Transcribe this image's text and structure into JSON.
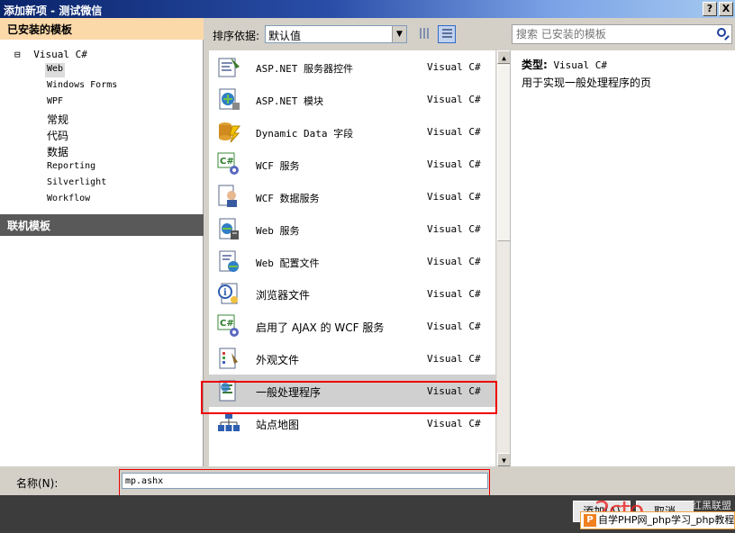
{
  "window": {
    "title": "添加新项 - 测试微信",
    "help_button": "?",
    "close_button": "X"
  },
  "left_panel": {
    "installed_header": "已安装的模板",
    "tree": {
      "root_expander": "⊟",
      "root_label": "Visual C#",
      "children": [
        "Web",
        "Windows Forms",
        "WPF",
        "常规",
        "代码",
        "数据",
        "Reporting",
        "Silverlight",
        "Workflow"
      ],
      "selected": "Web"
    },
    "online_header": "联机模板"
  },
  "toolbar": {
    "sort_label": "排序依据:",
    "sort_value": "默认值",
    "search_placeholder": "搜索 已安装的模板"
  },
  "items": [
    {
      "name": "ASP.NET 服务器控件",
      "lang": "Visual C#",
      "icon": "server-control-icon"
    },
    {
      "name": "ASP.NET 模块",
      "lang": "Visual C#",
      "icon": "module-icon"
    },
    {
      "name": "Dynamic Data 字段",
      "lang": "Visual C#",
      "icon": "dynamic-data-icon"
    },
    {
      "name": "WCF 服务",
      "lang": "Visual C#",
      "icon": "wcf-service-icon"
    },
    {
      "name": "WCF 数据服务",
      "lang": "Visual C#",
      "icon": "wcf-data-service-icon"
    },
    {
      "name": "Web 服务",
      "lang": "Visual C#",
      "icon": "web-service-icon"
    },
    {
      "name": "Web 配置文件",
      "lang": "Visual C#",
      "icon": "web-config-icon"
    },
    {
      "name": "浏览器文件",
      "lang": "Visual C#",
      "icon": "browser-file-icon"
    },
    {
      "name": "启用了 AJAX 的 WCF 服务",
      "lang": "Visual C#",
      "icon": "ajax-wcf-service-icon"
    },
    {
      "name": "外观文件",
      "lang": "Visual C#",
      "icon": "skin-file-icon"
    },
    {
      "name": "一般处理程序",
      "lang": "Visual C#",
      "icon": "generic-handler-icon"
    },
    {
      "name": "站点地图",
      "lang": "Visual C#",
      "icon": "sitemap-icon"
    }
  ],
  "selected_item": "一般处理程序",
  "details": {
    "type_label": "类型:",
    "type_value": "Visual C#",
    "description": "用于实现一般处理程序的页"
  },
  "name_field": {
    "label": "名称(N):",
    "value": "mp.ashx"
  },
  "buttons": {
    "add": "添加(A)",
    "cancel": "取消"
  },
  "watermark": {
    "mark": "2cto",
    "tag": "红黑联盟",
    "footer": "自学PHP网_php学习_php教程"
  },
  "colors": {
    "title_bar": "#0a246a",
    "installed_header_bg": "#fcd9a9",
    "online_header_bg": "#595959",
    "highlight_box": "#e00000"
  }
}
